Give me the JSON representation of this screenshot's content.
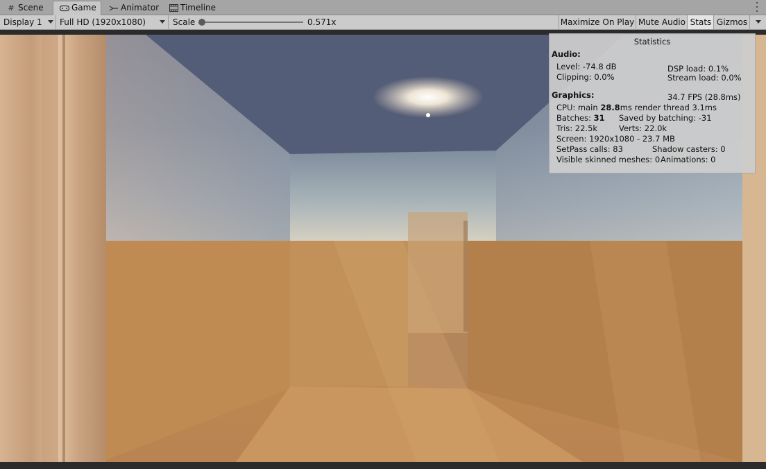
{
  "tabs": [
    {
      "label": "Scene",
      "icon": "grid-icon"
    },
    {
      "label": "Game",
      "icon": "gamepad-icon"
    },
    {
      "label": "Animator",
      "icon": "animator-icon"
    },
    {
      "label": "Timeline",
      "icon": "timeline-icon"
    }
  ],
  "toolbar": {
    "display": "Display 1",
    "resolution": "Full HD (1920x1080)",
    "scale_label": "Scale",
    "scale_value": "0.571x",
    "maximize": "Maximize On Play",
    "mute": "Mute Audio",
    "stats": "Stats",
    "gizmos": "Gizmos"
  },
  "stats": {
    "title": "Statistics",
    "audio_header": "Audio:",
    "level": "Level: -74.8 dB",
    "clipping": "Clipping: 0.0%",
    "dsp": "DSP load: 0.1%",
    "stream": "Stream load: 0.0%",
    "graphics_header": "Graphics:",
    "fps": "34.7 FPS (28.8ms)",
    "cpu_prefix": "CPU: main ",
    "cpu_main": "28.8",
    "cpu_suffix": "ms  render thread 3.1ms",
    "batches_prefix": "Batches: ",
    "batches": "31",
    "saved": "Saved by batching: -31",
    "tris": "Tris: 22.5k",
    "verts": "Verts: 22.0k",
    "screen": "Screen: 1920x1080 - 23.7 MB",
    "setpass": "SetPass calls: 83",
    "shadow": "Shadow casters: 0",
    "skinned": "Visible skinned meshes: 0",
    "animations": "Animations: 0"
  },
  "colors": {
    "sand": "#c08a4e",
    "sky": "#5d6e8a",
    "panel": "#cecece"
  }
}
